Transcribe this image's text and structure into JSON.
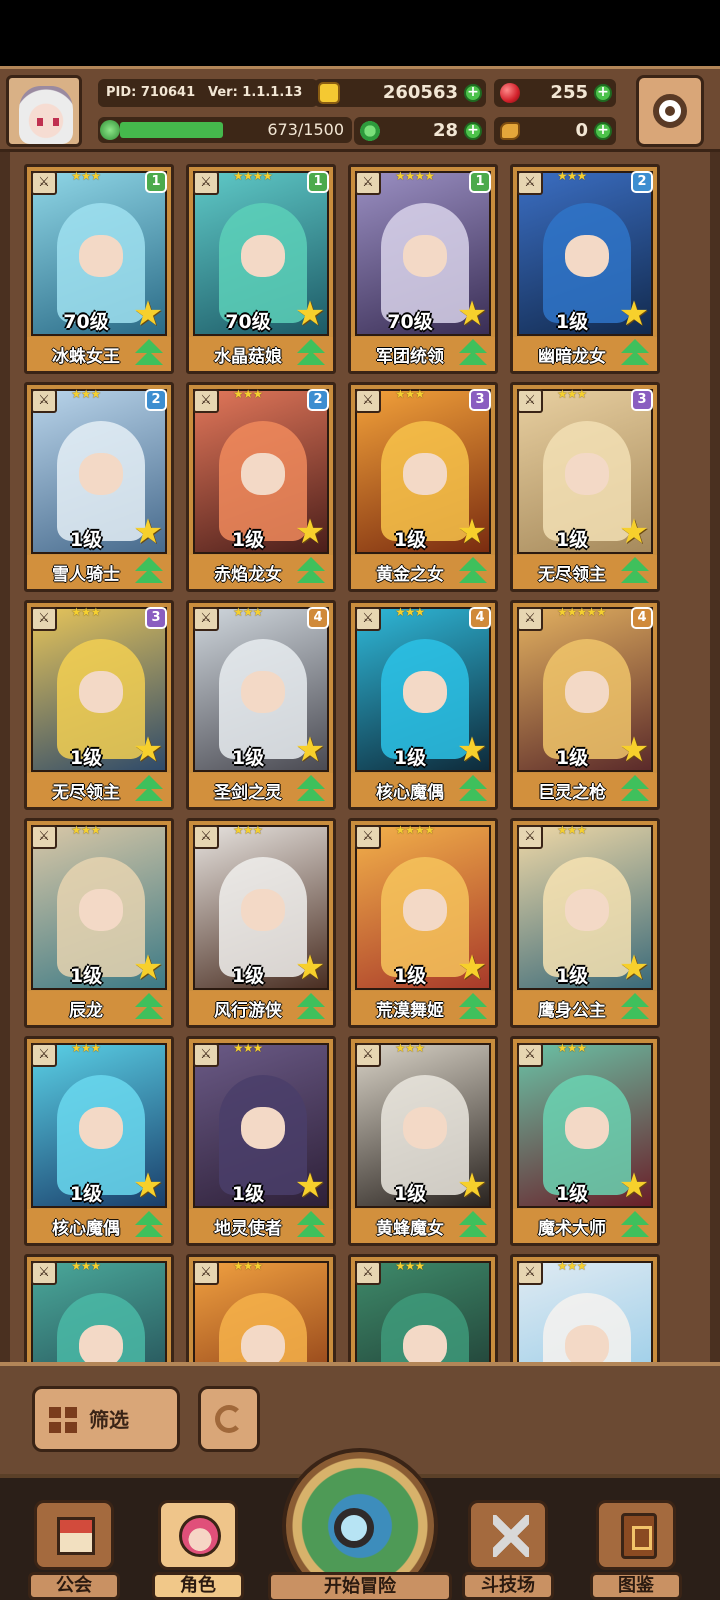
{
  "header": {
    "pid": "PID: 710641",
    "version": "Ver: 1.1.1.13",
    "gold": "260563",
    "gems": "255",
    "clovers": "28",
    "keys": "0",
    "xp_text": "673/1500",
    "xp_progress": 0.449
  },
  "cards": [
    {
      "name": "冰蛛女王",
      "level": "70级",
      "stars": "★★★",
      "rank": "1",
      "rank_color": "#4caa4c",
      "art": [
        "#8fd6e6",
        "#2a6a86"
      ],
      "hair": "#9fe0f0"
    },
    {
      "name": "水晶菇娘",
      "level": "70级",
      "stars": "★★★★",
      "rank": "1",
      "rank_color": "#4caa4c",
      "art": [
        "#5fc9c7",
        "#1d5a66"
      ],
      "hair": "#5cd0b8"
    },
    {
      "name": "军团统领",
      "level": "70级",
      "stars": "★★★★",
      "rank": "1",
      "rank_color": "#4caa4c",
      "art": [
        "#9a8fc2",
        "#3a2e55"
      ],
      "hair": "#d8d2ea"
    },
    {
      "name": "幽暗龙女",
      "level": "1级",
      "stars": "★★★",
      "rank": "2",
      "rank_color": "#3d8ed0",
      "art": [
        "#3b6ec2",
        "#122a4e"
      ],
      "hair": "#2f74c8"
    },
    {
      "name": "雪人骑士",
      "level": "1级",
      "stars": "★★★",
      "rank": "2",
      "rank_color": "#3d8ed0",
      "art": [
        "#b9d4ea",
        "#476a8c"
      ],
      "hair": "#e4eef6"
    },
    {
      "name": "赤焰龙女",
      "level": "1级",
      "stars": "★★★",
      "rank": "2",
      "rank_color": "#3d8ed0",
      "art": [
        "#e2775a",
        "#4a1e1a"
      ],
      "hair": "#f08a5c"
    },
    {
      "name": "黄金之女",
      "level": "1级",
      "stars": "★★★",
      "rank": "3",
      "rank_color": "#8a5ec0",
      "art": [
        "#f2a13a",
        "#7a2c10"
      ],
      "hair": "#f7c24a"
    },
    {
      "name": "无尽领主",
      "level": "1级",
      "stars": "★★★",
      "rank": "3",
      "rank_color": "#8a5ec0",
      "art": [
        "#e8cfa0",
        "#a68a5c"
      ],
      "hair": "#f2dfb4"
    },
    {
      "name": "无尽领主",
      "level": "1级",
      "stars": "★★★",
      "rank": "3",
      "rank_color": "#8a5ec0",
      "art": [
        "#e6c45a",
        "#2e4a6a"
      ],
      "hair": "#f2cf52"
    },
    {
      "name": "圣剑之灵",
      "level": "1级",
      "stars": "★★★",
      "rank": "4",
      "rank_color": "#d08a3a",
      "art": [
        "#cfd6dc",
        "#4a4a52"
      ],
      "hair": "#e8ecf0"
    },
    {
      "name": "核心魔偶",
      "level": "1级",
      "stars": "★★★",
      "rank": "4",
      "rank_color": "#d08a3a",
      "art": [
        "#2fb8d8",
        "#0e2a3a"
      ],
      "hair": "#2bc2e6"
    },
    {
      "name": "巨灵之枪",
      "level": "1级",
      "stars": "★★★★★",
      "rank": "4",
      "rank_color": "#d08a3a",
      "art": [
        "#e2b060",
        "#5a2a2a"
      ],
      "hair": "#f0c46a"
    },
    {
      "name": "辰龙",
      "level": "1级",
      "stars": "★★★",
      "rank": "",
      "rank_color": "",
      "art": [
        "#d9c7a6",
        "#3c7a86"
      ],
      "hair": "#e6d3b0"
    },
    {
      "name": "风行游侠",
      "level": "1级",
      "stars": "★★★",
      "rank": "",
      "rank_color": "",
      "art": [
        "#e6e2de",
        "#4a2e22"
      ],
      "hair": "#f0eeec"
    },
    {
      "name": "荒漠舞姬",
      "level": "1级",
      "stars": "★★★★",
      "rank": "",
      "rank_color": "",
      "art": [
        "#f2b04a",
        "#a83a2a"
      ],
      "hair": "#f6c35c"
    },
    {
      "name": "鹰身公主",
      "level": "1级",
      "stars": "★★★",
      "rank": "",
      "rank_color": "",
      "art": [
        "#eed7a6",
        "#3a6a7a"
      ],
      "hair": "#f6e2b2"
    },
    {
      "name": "核心魔偶",
      "level": "1级",
      "stars": "★★★",
      "rank": "",
      "rank_color": "",
      "art": [
        "#5ad0e6",
        "#1a3e6a"
      ],
      "hair": "#6ad8ee"
    },
    {
      "name": "地灵使者",
      "level": "1级",
      "stars": "★★★",
      "rank": "",
      "rank_color": "",
      "art": [
        "#6a5a86",
        "#2e2038"
      ],
      "hair": "#4a3e6a"
    },
    {
      "name": "黄蜂魔女",
      "level": "1级",
      "stars": "★★★",
      "rank": "",
      "rank_color": "",
      "art": [
        "#d8d2c6",
        "#2a2420"
      ],
      "hair": "#eae6de"
    },
    {
      "name": "魔术大师",
      "level": "1级",
      "stars": "★★★",
      "rank": "",
      "rank_color": "",
      "art": [
        "#6ac2a6",
        "#6a1e28"
      ],
      "hair": "#6ad2b2"
    },
    {
      "name": "",
      "level": "",
      "stars": "★★★",
      "rank": "",
      "rank_color": "",
      "art": [
        "#4aa89a",
        "#1e3e4a"
      ],
      "hair": "#4ab8a6"
    },
    {
      "name": "",
      "level": "",
      "stars": "★★★",
      "rank": "",
      "rank_color": "",
      "art": [
        "#f0a040",
        "#7a2c10"
      ],
      "hair": "#f6b24a"
    },
    {
      "name": "",
      "level": "",
      "stars": "★★★",
      "rank": "",
      "rank_color": "",
      "art": [
        "#3e8a6a",
        "#1a2e2a"
      ],
      "hair": "#3e9a7a"
    },
    {
      "name": "",
      "level": "",
      "stars": "★★★",
      "rank": "",
      "rank_color": "",
      "art": [
        "#dfeaf2",
        "#8ac6e6"
      ],
      "hair": "#f6f2ee"
    }
  ],
  "filter": {
    "filter_label": "筛选"
  },
  "nav": {
    "guild": "公会",
    "character": "角色",
    "adventure": "开始冒险",
    "arena": "斗技场",
    "codex": "图鉴"
  }
}
